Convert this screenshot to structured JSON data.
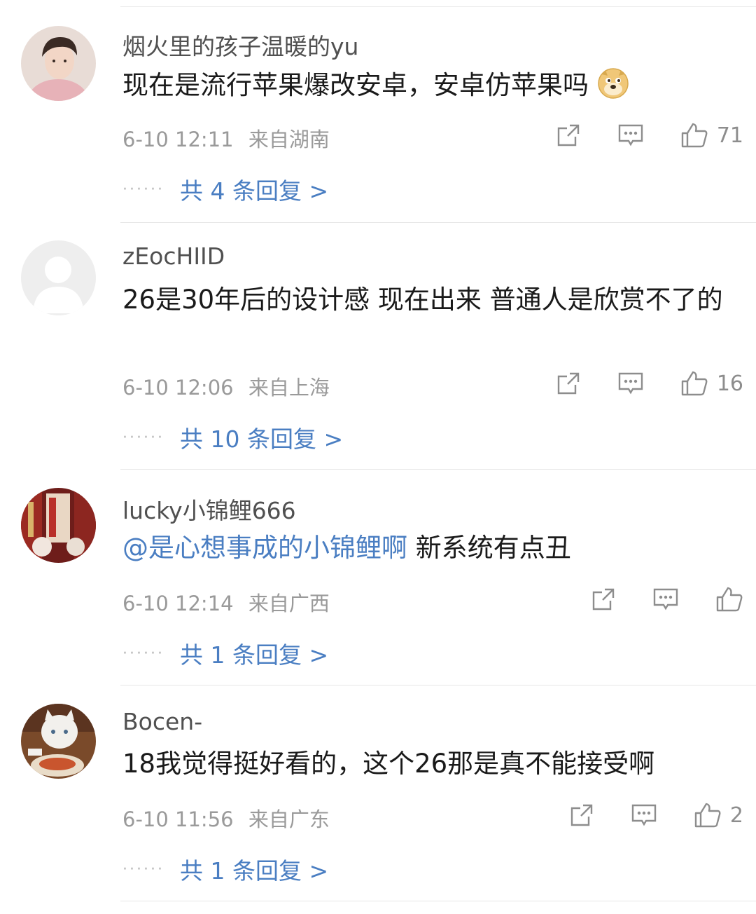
{
  "comments": [
    {
      "username": "烟火里的孩子温暖的yu",
      "text": "现在是流行苹果爆改安卓，安卓仿苹果吗",
      "emoji": "doge-emoji",
      "time": "6-10 12:11",
      "location": "来自湖南",
      "likes": "71",
      "replies": "共 4 条回复 >"
    },
    {
      "username": "zEocHIID",
      "text": "26是30年后的设计感 现在出来 普通人是欣赏不了的",
      "time": "6-10 12:06",
      "location": "来自上海",
      "likes": "16",
      "replies": "共 10 条回复 >"
    },
    {
      "username": "lucky小锦鲤666",
      "mention": "@是心想事成的小锦鲤啊",
      "text": " 新系统有点丑",
      "time": "6-10 12:14",
      "location": "来自广西",
      "replies": "共 1 条回复 >"
    },
    {
      "username": "Bocen-",
      "text": "18我觉得挺好看的，这个26那是真不能接受啊",
      "time": "6-10 11:56",
      "location": "来自广东",
      "likes": "2",
      "replies": "共 1 条回复 >"
    }
  ],
  "colors": {
    "link": "#4a7ec2",
    "meta": "#9a9a9a",
    "divider": "#e6e6e6"
  },
  "icons": [
    "share-icon",
    "comment-icon",
    "thumbs-up-icon"
  ]
}
